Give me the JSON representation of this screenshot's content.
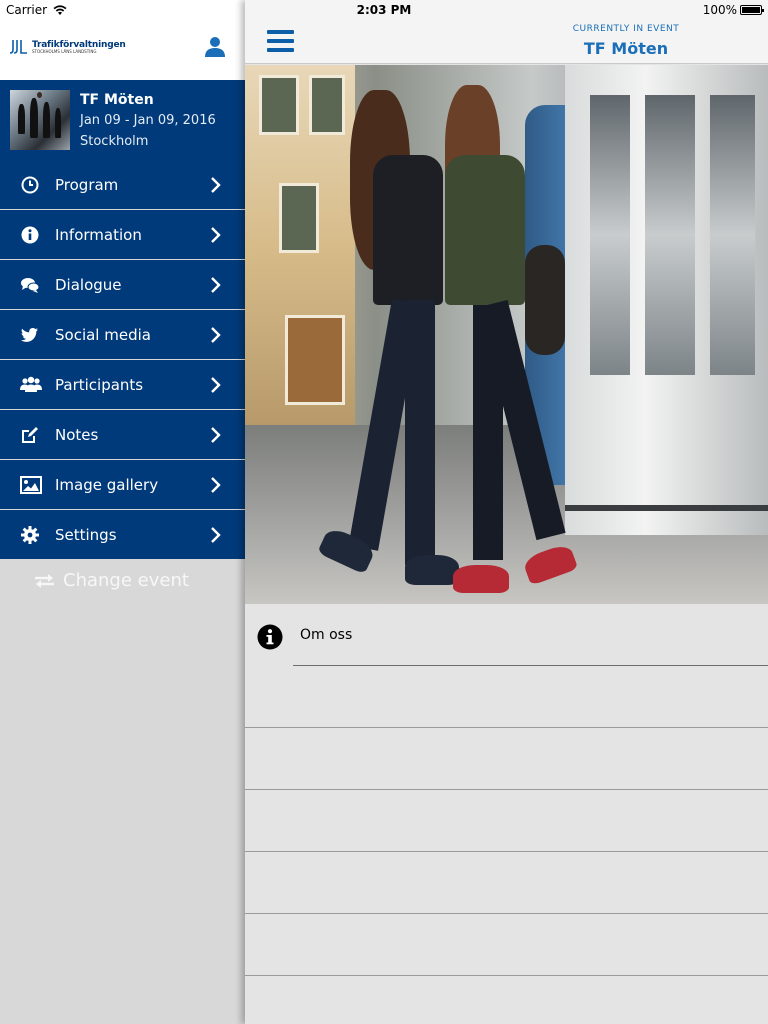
{
  "status_bar": {
    "carrier": "Carrier",
    "time": "2:03 PM",
    "battery": "100%"
  },
  "sidebar": {
    "logo": {
      "name": "Trafikförvaltningen",
      "sub": "STOCKHOLMS LÄNS LANDSTING"
    },
    "event": {
      "title": "TF Möten",
      "dates": "Jan 09 - Jan 09, 2016",
      "location": "Stockholm"
    },
    "menu": [
      {
        "label": "Program",
        "icon": "clock-icon"
      },
      {
        "label": "Information",
        "icon": "info-icon"
      },
      {
        "label": "Dialogue",
        "icon": "chat-bubbles-icon"
      },
      {
        "label": "Social media",
        "icon": "twitter-bird-icon"
      },
      {
        "label": "Participants",
        "icon": "people-icon"
      },
      {
        "label": "Notes",
        "icon": "edit-note-icon"
      },
      {
        "label": "Image gallery",
        "icon": "picture-icon"
      },
      {
        "label": "Settings",
        "icon": "gear-icon"
      }
    ],
    "change_event": "Change event"
  },
  "navbar": {
    "pretitle": "CURRENTLY IN EVENT",
    "title": "TF Möten"
  },
  "content": {
    "rows": [
      {
        "label": "Om oss",
        "icon": "info-circle-icon"
      }
    ]
  },
  "colors": {
    "brand_blue": "#003a7a",
    "accent_blue": "#1a6fb8",
    "sidebar_bg": "#d8d8d8",
    "content_bg": "#e4e4e4"
  }
}
